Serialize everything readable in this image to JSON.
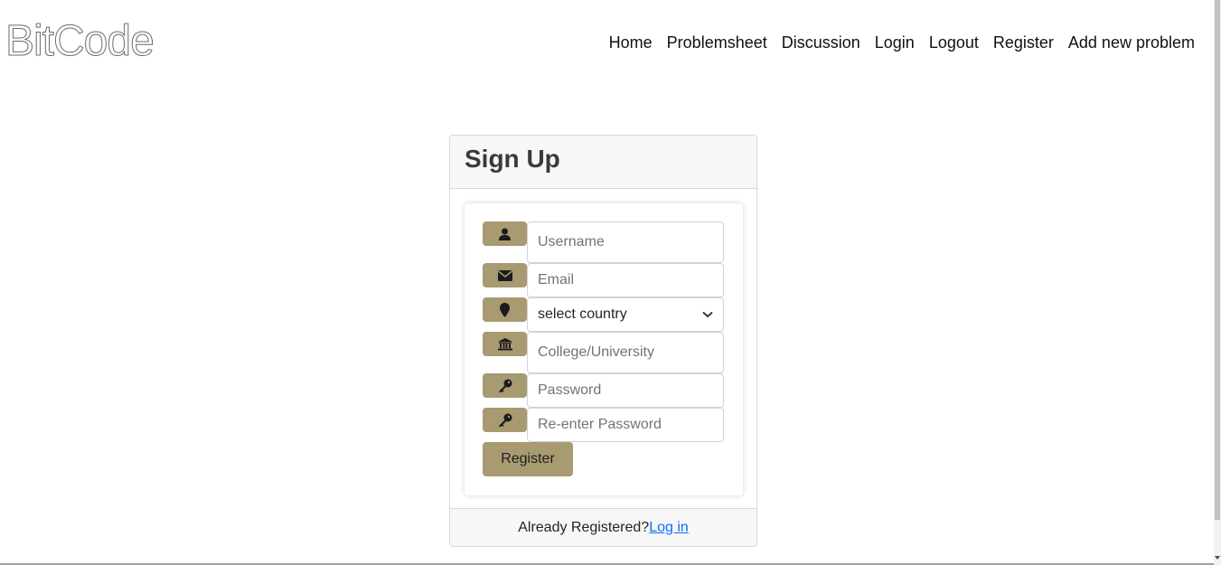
{
  "brand": {
    "name": "BitCode"
  },
  "nav": {
    "items": [
      {
        "label": "Home"
      },
      {
        "label": "Problemsheet"
      },
      {
        "label": "Discussion"
      },
      {
        "label": "Login"
      },
      {
        "label": "Logout"
      },
      {
        "label": "Register"
      },
      {
        "label": "Add new problem"
      }
    ]
  },
  "signup": {
    "title": "Sign Up",
    "fields": {
      "username": {
        "placeholder": "Username",
        "icon": "user-icon"
      },
      "email": {
        "placeholder": "Email",
        "icon": "envelope-icon"
      },
      "country": {
        "value": "select country",
        "icon": "map-marker-icon"
      },
      "college": {
        "placeholder": "College/University",
        "icon": "institution-icon"
      },
      "password": {
        "placeholder": "Password",
        "icon": "key-icon"
      },
      "repassword": {
        "placeholder": "Re-enter Password",
        "icon": "key-icon"
      }
    },
    "register_label": "Register",
    "footer": {
      "text": "Already Registered?",
      "link": "Log in"
    }
  },
  "colors": {
    "accent": "#a89a71",
    "link": "#0d6efd",
    "card_bg": "#f7f7f7"
  }
}
